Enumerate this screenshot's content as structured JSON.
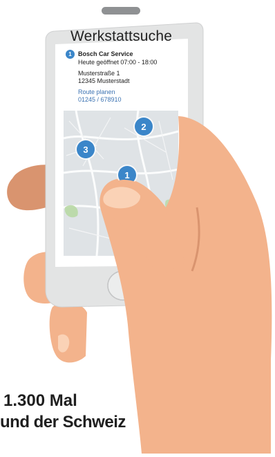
{
  "app": {
    "title": "Werkstattsuche"
  },
  "result": {
    "marker": "1",
    "name": "Bosch Car Service",
    "hours": "Heute geöffnet 07:00 - 18:00",
    "street": "Musterstraße 1",
    "city": "12345 Musterstadt",
    "route_link": "Route planen",
    "phone_link": "01245 / 678910"
  },
  "map": {
    "pins": [
      {
        "label": "2"
      },
      {
        "label": "3"
      },
      {
        "label": "1"
      }
    ]
  },
  "caption": {
    "line1": "1.300 Mal",
    "line2": "und der Schweiz"
  },
  "colors": {
    "accent": "#3b86c9",
    "link": "#3b72b2",
    "skin": "#f3b38c",
    "skin_shadow": "#d9946f"
  }
}
